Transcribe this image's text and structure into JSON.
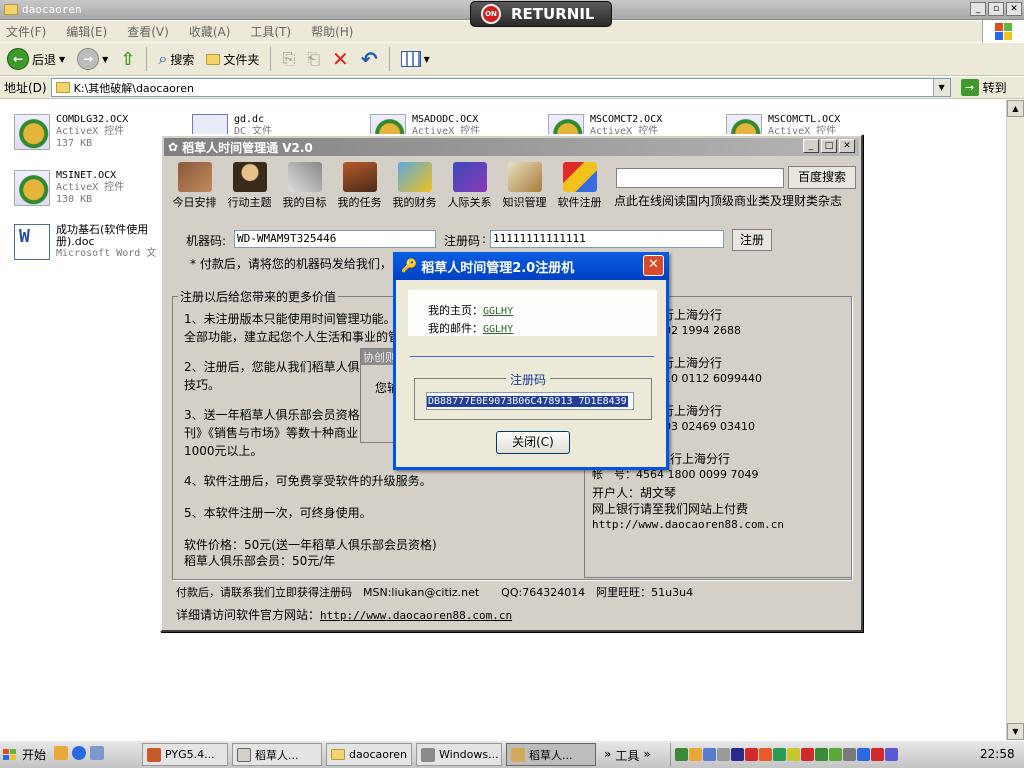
{
  "explorer": {
    "title": "daocaoren",
    "returnil_label": "RETURNIL",
    "returnil_shield": "ON",
    "menu": [
      "文件(F)",
      "编辑(E)",
      "查看(V)",
      "收藏(A)",
      "工具(T)",
      "帮助(H)"
    ],
    "toolbar": {
      "back": "后退",
      "search": "搜索",
      "folders": "文件夹"
    },
    "address_label": "地址(D)",
    "address_value": "K:\\其他破解\\daocaoren",
    "go_label": "转到"
  },
  "files": [
    {
      "name": "COMDLG32.OCX",
      "type": "ActiveX 控件",
      "size": "137 KB"
    },
    {
      "name": "gd.dc",
      "type": "DC 文件",
      "size": ""
    },
    {
      "name": "MSADODC.OCX",
      "type": "ActiveX 控件",
      "size": ""
    },
    {
      "name": "MSCOMCT2.OCX",
      "type": "ActiveX 控件",
      "size": ""
    },
    {
      "name": "MSCOMCTL.OCX",
      "type": "ActiveX 控件",
      "size": ""
    },
    {
      "name": "MSINET.OCX",
      "type": "ActiveX 控件",
      "size": "130 KB"
    },
    {
      "name": "成功基石(软件使用册).doc",
      "type": "Microsoft Word 文",
      "size": ""
    }
  ],
  "app": {
    "title": "稻草人时间管理通 V2.0",
    "icons": [
      "今日安排",
      "行动主题",
      "我的目标",
      "我的任务",
      "我的财务",
      "人际关系",
      "知识管理",
      "软件注册"
    ],
    "search_button": "百度搜索",
    "tagline": "点此在线阅读国内顶级商业类及理财类杂志",
    "machine_code_label": "机器码:",
    "machine_code_value": "WD-WMAM9T325446",
    "reg_code_label": "注册码",
    "reg_code_value": "11111111111111",
    "register_button": "注册",
    "note": "* 付款后，请将您的机器码发给我们，",
    "group_title": "注册以后给您带来的更多价值",
    "paragraphs": [
      "1、未注册版本只能使用时间管理功能。",
      "全部功能，建立起您个人生活和事业的管",
      "2、注册后，您能从我们稻草人俱",
      "技巧。",
      "3、送一年稻草人俱乐部会员资格",
      "刊》《销售与市场》等数十种商业",
      "1000元以上。",
      "4、软件注册后，可免费享受软件的升级服务。",
      "5、本软件注册一次，可终身使用。",
      "软件价格：50元(送一年稻草人俱乐部会员资格)",
      "稻草人俱乐部会员：50元/年"
    ],
    "bank_lines": [
      "银行上海分行",
      "8802 1994 2688",
      "银行上海分行",
      "0010 0112 6099440",
      "银行上海分行",
      "8003 02469 03410",
      "浦东发展银行上海分行",
      "帐　号：4564 1800 0099 7049",
      "开户人：胡文琴",
      "网上银行请至我们网站上付费",
      "http://www.daocaoren88.com.cn"
    ],
    "msg_stub_title": "协创则",
    "msg_stub_text": "您输",
    "footer1": "付款后，请联系我们立即获得注册码　MSN:liukan@citiz.net　　QQ:764324014　阿里旺旺：51u3u4",
    "footer2_label": "详细请访问软件官方网站：",
    "footer2_link": "http://www.daocaoren88.com.cn"
  },
  "keygen": {
    "title": "稻草人时间管理2.0注册机",
    "homepage_label": "我的主页：",
    "homepage_value": "GGLHY",
    "email_label": "我的邮件：",
    "email_value": "GGLHY",
    "code_group_label": "注册码",
    "code_value": "DB88777E0E9073B06C478913 7D1E8439",
    "close_button": "关闭(C)"
  },
  "taskbar": {
    "start": "开始",
    "items": [
      "PYG5.4...",
      "稻草人...",
      "daocaoren",
      "Windows...",
      "稻草人..."
    ],
    "tools": "工具",
    "clock": "22:58"
  }
}
